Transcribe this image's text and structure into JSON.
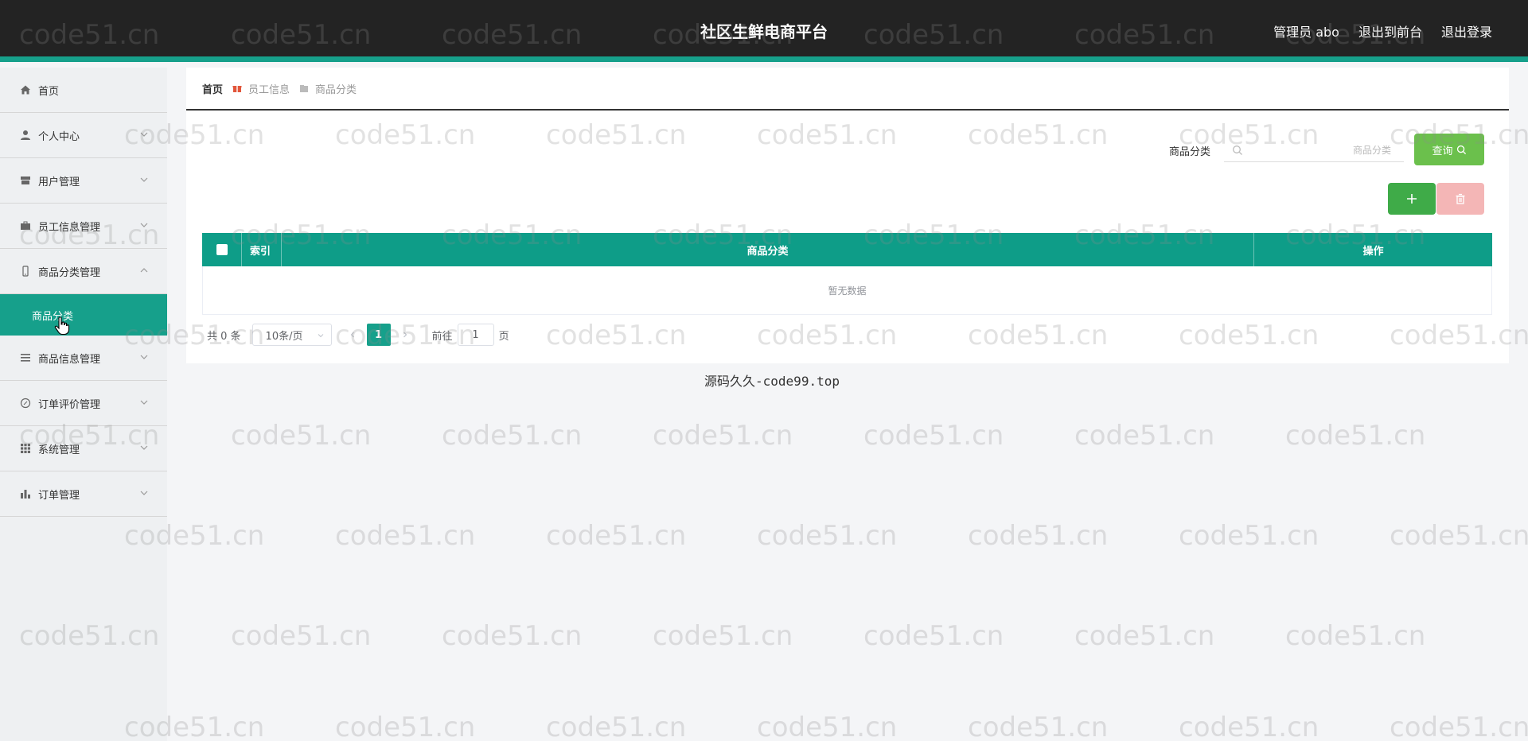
{
  "header": {
    "title": "社区生鲜电商平台",
    "admin_label": "管理员 abo",
    "to_front": "退出到前台",
    "logout": "退出登录"
  },
  "sidebar": {
    "items": [
      {
        "label": "首页",
        "icon": "home-icon"
      },
      {
        "label": "个人中心",
        "icon": "user-icon"
      },
      {
        "label": "用户管理",
        "icon": "store-icon"
      },
      {
        "label": "员工信息管理",
        "icon": "briefcase-icon"
      },
      {
        "label": "商品分类管理",
        "icon": "phone-icon"
      },
      {
        "label": "商品信息管理",
        "icon": "list-icon"
      },
      {
        "label": "订单评价管理",
        "icon": "compass-icon"
      },
      {
        "label": "系统管理",
        "icon": "grid-icon"
      },
      {
        "label": "订单管理",
        "icon": "bar-chart-icon"
      }
    ],
    "sub_item_active": "商品分类"
  },
  "breadcrumb": {
    "home": "首页",
    "level1": "员工信息",
    "level2": "商品分类"
  },
  "search": {
    "label": "商品分类",
    "placeholder": "商品分类",
    "query_button": "查询"
  },
  "table": {
    "columns": [
      "索引",
      "商品分类",
      "操作"
    ],
    "empty_text": "暂无数据"
  },
  "pagination": {
    "total": "共 0 条",
    "page_size": "10条/页",
    "current_page": "1",
    "goto_label": "前往",
    "goto_value": "1",
    "page_suffix": "页"
  },
  "footer_note": "源码久久-code99.top",
  "watermark_text": "code51.cn",
  "colors": {
    "topbar": "#232323",
    "accent": "#16a08b",
    "query_button": "#6bc04c",
    "add_button": "#3fab48",
    "delete_button": "#f4b6b6"
  }
}
